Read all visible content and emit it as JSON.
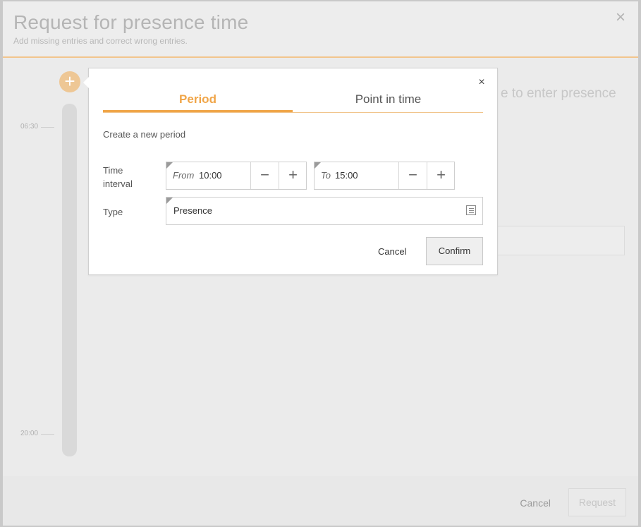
{
  "main": {
    "title": "Request for presence time",
    "subtitle": "Add missing entries and correct wrong entries.",
    "close_icon": "close-icon",
    "timeline_labels": [
      "06:30",
      "20:00"
    ],
    "background_hint": "e to enter presence",
    "footer": {
      "cancel_label": "Cancel",
      "request_label": "Request"
    }
  },
  "popup": {
    "close_icon": "close-icon",
    "tabs": [
      {
        "label": "Period",
        "active": true
      },
      {
        "label": "Point in time",
        "active": false
      }
    ],
    "section_title": "Create a new period",
    "time_interval_label": "Time interval",
    "from": {
      "prefix": "From",
      "value": "10:00"
    },
    "to": {
      "prefix": "To",
      "value": "15:00"
    },
    "type_label": "Type",
    "type_value": "Presence",
    "cancel_label": "Cancel",
    "confirm_label": "Confirm"
  },
  "colors": {
    "accent": "#f0a548",
    "accent_light": "#eec795"
  }
}
